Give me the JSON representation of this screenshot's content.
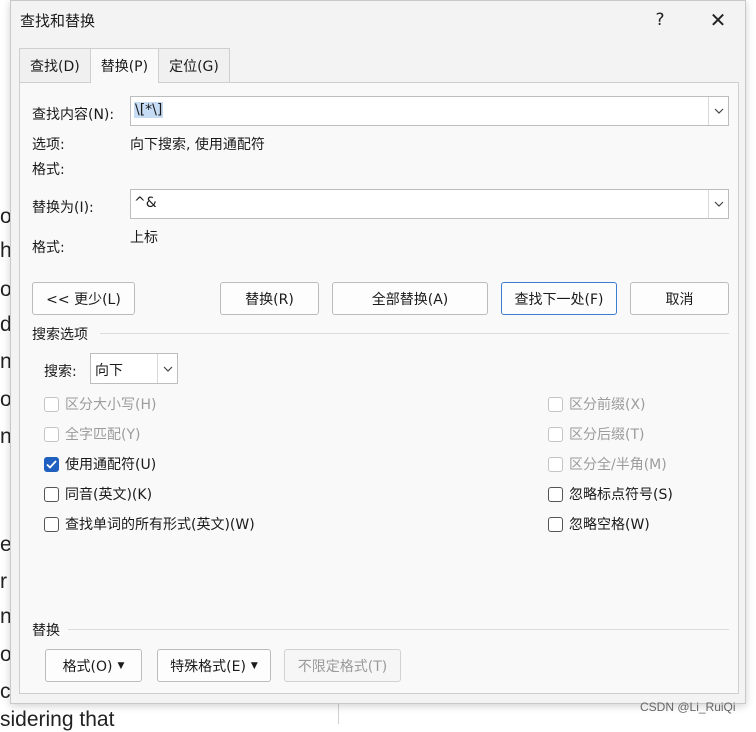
{
  "dialog": {
    "title": "查找和替换",
    "help_label": "?",
    "close_label": "✕",
    "tabs": [
      {
        "label": "查找(D)",
        "active": false
      },
      {
        "label": "替换(P)",
        "active": true
      },
      {
        "label": "定位(G)",
        "active": false
      }
    ]
  },
  "find": {
    "label": "查找内容(N):",
    "value": "\\[*\\]",
    "options_label": "选项:",
    "options_value": "向下搜索, 使用通配符",
    "format_label": "格式:",
    "format_value": ""
  },
  "replace": {
    "label": "替换为(I):",
    "value": "^&",
    "format_label": "格式:",
    "format_value": "上标"
  },
  "buttons": {
    "less": "<< 更少(L)",
    "replace": "替换(R)",
    "replace_all": "全部替换(A)",
    "find_next": "查找下一处(F)",
    "cancel": "取消"
  },
  "search_options": {
    "heading": "搜索选项",
    "direction_label": "搜索:",
    "direction_value": "向下",
    "left_checks": [
      {
        "label": "区分大小写(H)",
        "checked": false,
        "enabled": false
      },
      {
        "label": "全字匹配(Y)",
        "checked": false,
        "enabled": false
      },
      {
        "label": "使用通配符(U)",
        "checked": true,
        "enabled": true
      },
      {
        "label": "同音(英文)(K)",
        "checked": false,
        "enabled": true
      },
      {
        "label": "查找单词的所有形式(英文)(W)",
        "checked": false,
        "enabled": true
      }
    ],
    "right_checks": [
      {
        "label": "区分前缀(X)",
        "checked": false,
        "enabled": false
      },
      {
        "label": "区分后缀(T)",
        "checked": false,
        "enabled": false
      },
      {
        "label": "区分全/半角(M)",
        "checked": false,
        "enabled": false
      },
      {
        "label": "忽略标点符号(S)",
        "checked": false,
        "enabled": true
      },
      {
        "label": "忽略空格(W)",
        "checked": false,
        "enabled": true
      }
    ]
  },
  "replace_section": {
    "heading": "替换",
    "format_button": "格式(O)",
    "special_button": "特殊格式(E)",
    "no_format_button": "不限定格式(T)"
  },
  "background_doc": {
    "lines": [
      "o",
      "hi",
      "o",
      "d",
      "n",
      "ol",
      "n",
      "e",
      "r",
      "nt",
      "o",
      "cu",
      "sidering that"
    ]
  },
  "watermark": "CSDN @Li_RuiQi",
  "colors": {
    "dialog_bg": "#f3f3f3",
    "panel_bg": "#f9f9f9",
    "accent": "#1f5fbf",
    "selection": "#c6dcf5"
  }
}
